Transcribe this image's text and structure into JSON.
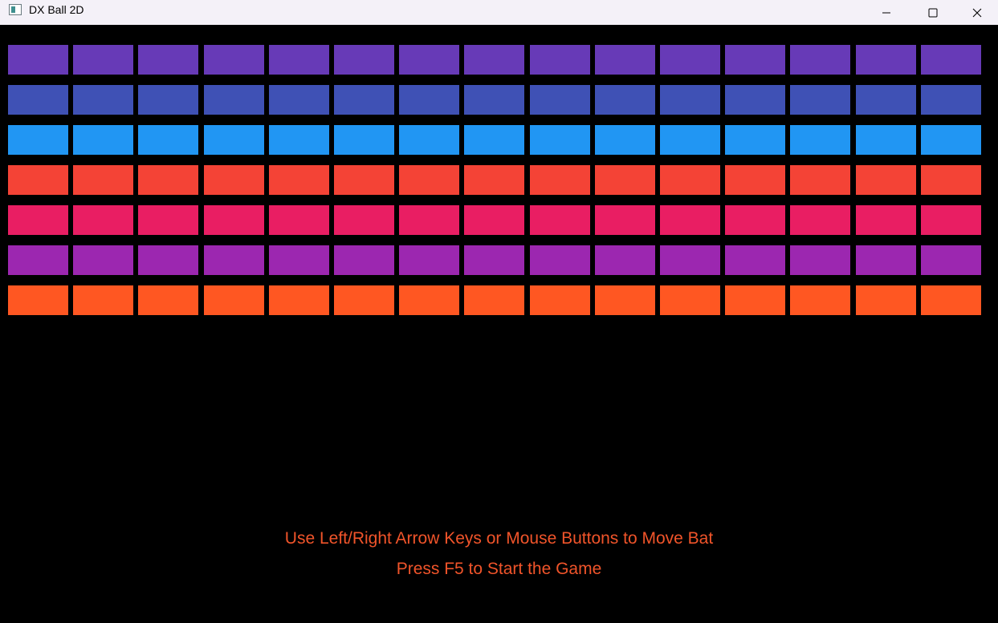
{
  "window": {
    "title": "DX Ball 2D",
    "app_icon": "application-window-icon",
    "controls": {
      "minimize_icon": "minimize-icon",
      "maximize_icon": "maximize-icon",
      "close_icon": "close-icon"
    }
  },
  "game": {
    "background_color": "#000000",
    "brick_columns": 15,
    "brick_rows": [
      {
        "color": "#673ab7"
      },
      {
        "color": "#3f51b5"
      },
      {
        "color": "#2196f3"
      },
      {
        "color": "#f44336"
      },
      {
        "color": "#e91e63"
      },
      {
        "color": "#9c27b0"
      },
      {
        "color": "#ff5722"
      }
    ],
    "message_color": "#f0542a",
    "messages": {
      "instructions": "Use Left/Right Arrow Keys or Mouse Buttons to Move Bat",
      "start_prompt": "Press F5 to Start the Game"
    }
  }
}
